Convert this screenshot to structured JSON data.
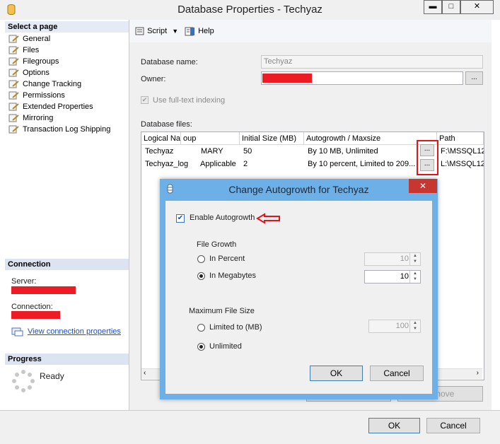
{
  "window": {
    "title": "Database Properties - Techyaz",
    "min": "▬",
    "max": "□",
    "close": "✕"
  },
  "sidebar": {
    "select_page": "Select a page",
    "items": [
      "General",
      "Files",
      "Filegroups",
      "Options",
      "Change Tracking",
      "Permissions",
      "Extended Properties",
      "Mirroring",
      "Transaction Log Shipping"
    ],
    "connection_head": "Connection",
    "server_label": "Server:",
    "connection_label": "Connection:",
    "view_link": "View connection properties",
    "progress_head": "Progress",
    "progress_status": "Ready"
  },
  "toolbar": {
    "script": "Script",
    "help": "Help"
  },
  "form": {
    "db_name_label": "Database name:",
    "db_name_value": "Techyaz",
    "owner_label": "Owner:",
    "browse": "...",
    "fulltext_label": "Use full-text indexing",
    "files_label": "Database files:"
  },
  "grid": {
    "headers": [
      "Logical Na",
      "oup",
      "Initial Size (MB)",
      "Autogrowth / Maxsize",
      "Path"
    ],
    "rows": [
      {
        "name": "Techyaz",
        "group": "MARY",
        "size": "50",
        "auto": "By 10 MB, Unlimited",
        "path": "F:\\MSSQL12"
      },
      {
        "name": "Techyaz_log",
        "group": "Applicable",
        "size": "2",
        "auto": "By 10 percent, Limited to 209...",
        "path": "L:\\MSSQL12"
      }
    ],
    "cell_btn": "..."
  },
  "behind_buttons": {
    "remove": "move"
  },
  "footer": {
    "ok": "OK",
    "cancel": "Cancel"
  },
  "dialog": {
    "title": "Change Autogrowth for Techyaz",
    "close": "✕",
    "enable_label": "Enable Autogrowth",
    "file_growth": "File Growth",
    "in_percent": "In Percent",
    "percent_value": "10",
    "in_mb": "In Megabytes",
    "mb_value": "10",
    "max_size": "Maximum File Size",
    "limited_to": "Limited to (MB)",
    "limited_value": "100",
    "unlimited": "Unlimited",
    "ok": "OK",
    "cancel": "Cancel"
  },
  "colors": {
    "accent_blue": "#6db0e8",
    "highlight_red": "#e1161d",
    "redaction": "#ed1c24"
  }
}
